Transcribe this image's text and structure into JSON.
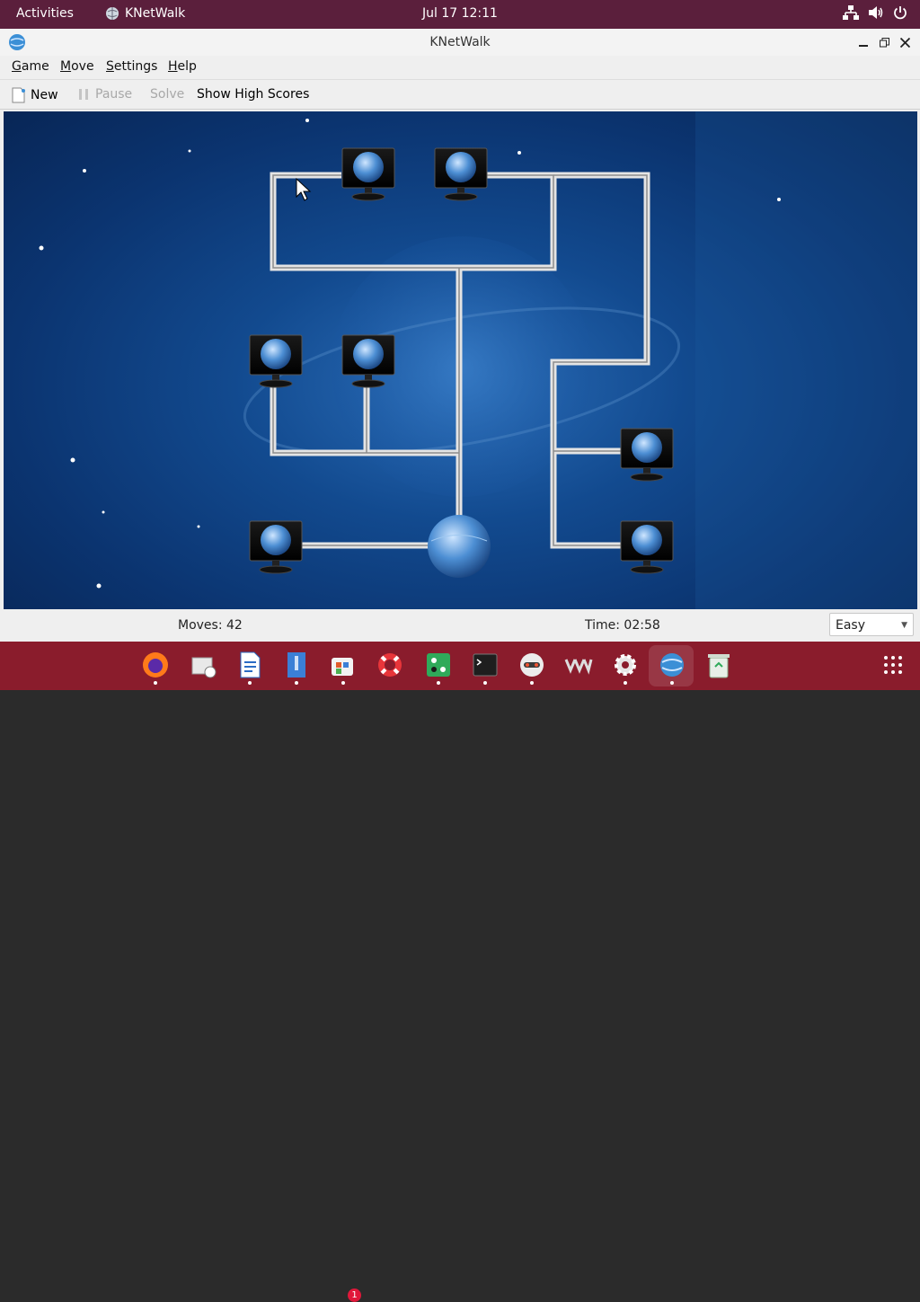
{
  "topbar": {
    "activities": "Activities",
    "app_name": "KNetWalk",
    "clock": "Jul 17  12:11"
  },
  "window": {
    "title": "KNetWalk"
  },
  "menu": {
    "game": "Game",
    "move": "Move",
    "settings": "Settings",
    "help": "Help"
  },
  "toolbar": {
    "new": "New",
    "pause": "Pause",
    "solve": "Solve",
    "high_scores": "Show High Scores"
  },
  "status": {
    "moves": "Moves: 42",
    "time": "Time: 02:58",
    "difficulty": "Easy"
  },
  "dock": {
    "notification_badge": "1"
  },
  "colors": {
    "top_bar": "#5b1f3c",
    "dock": "#8a1c2c",
    "board": "#124a8f",
    "cable": "#e8e8e8"
  }
}
